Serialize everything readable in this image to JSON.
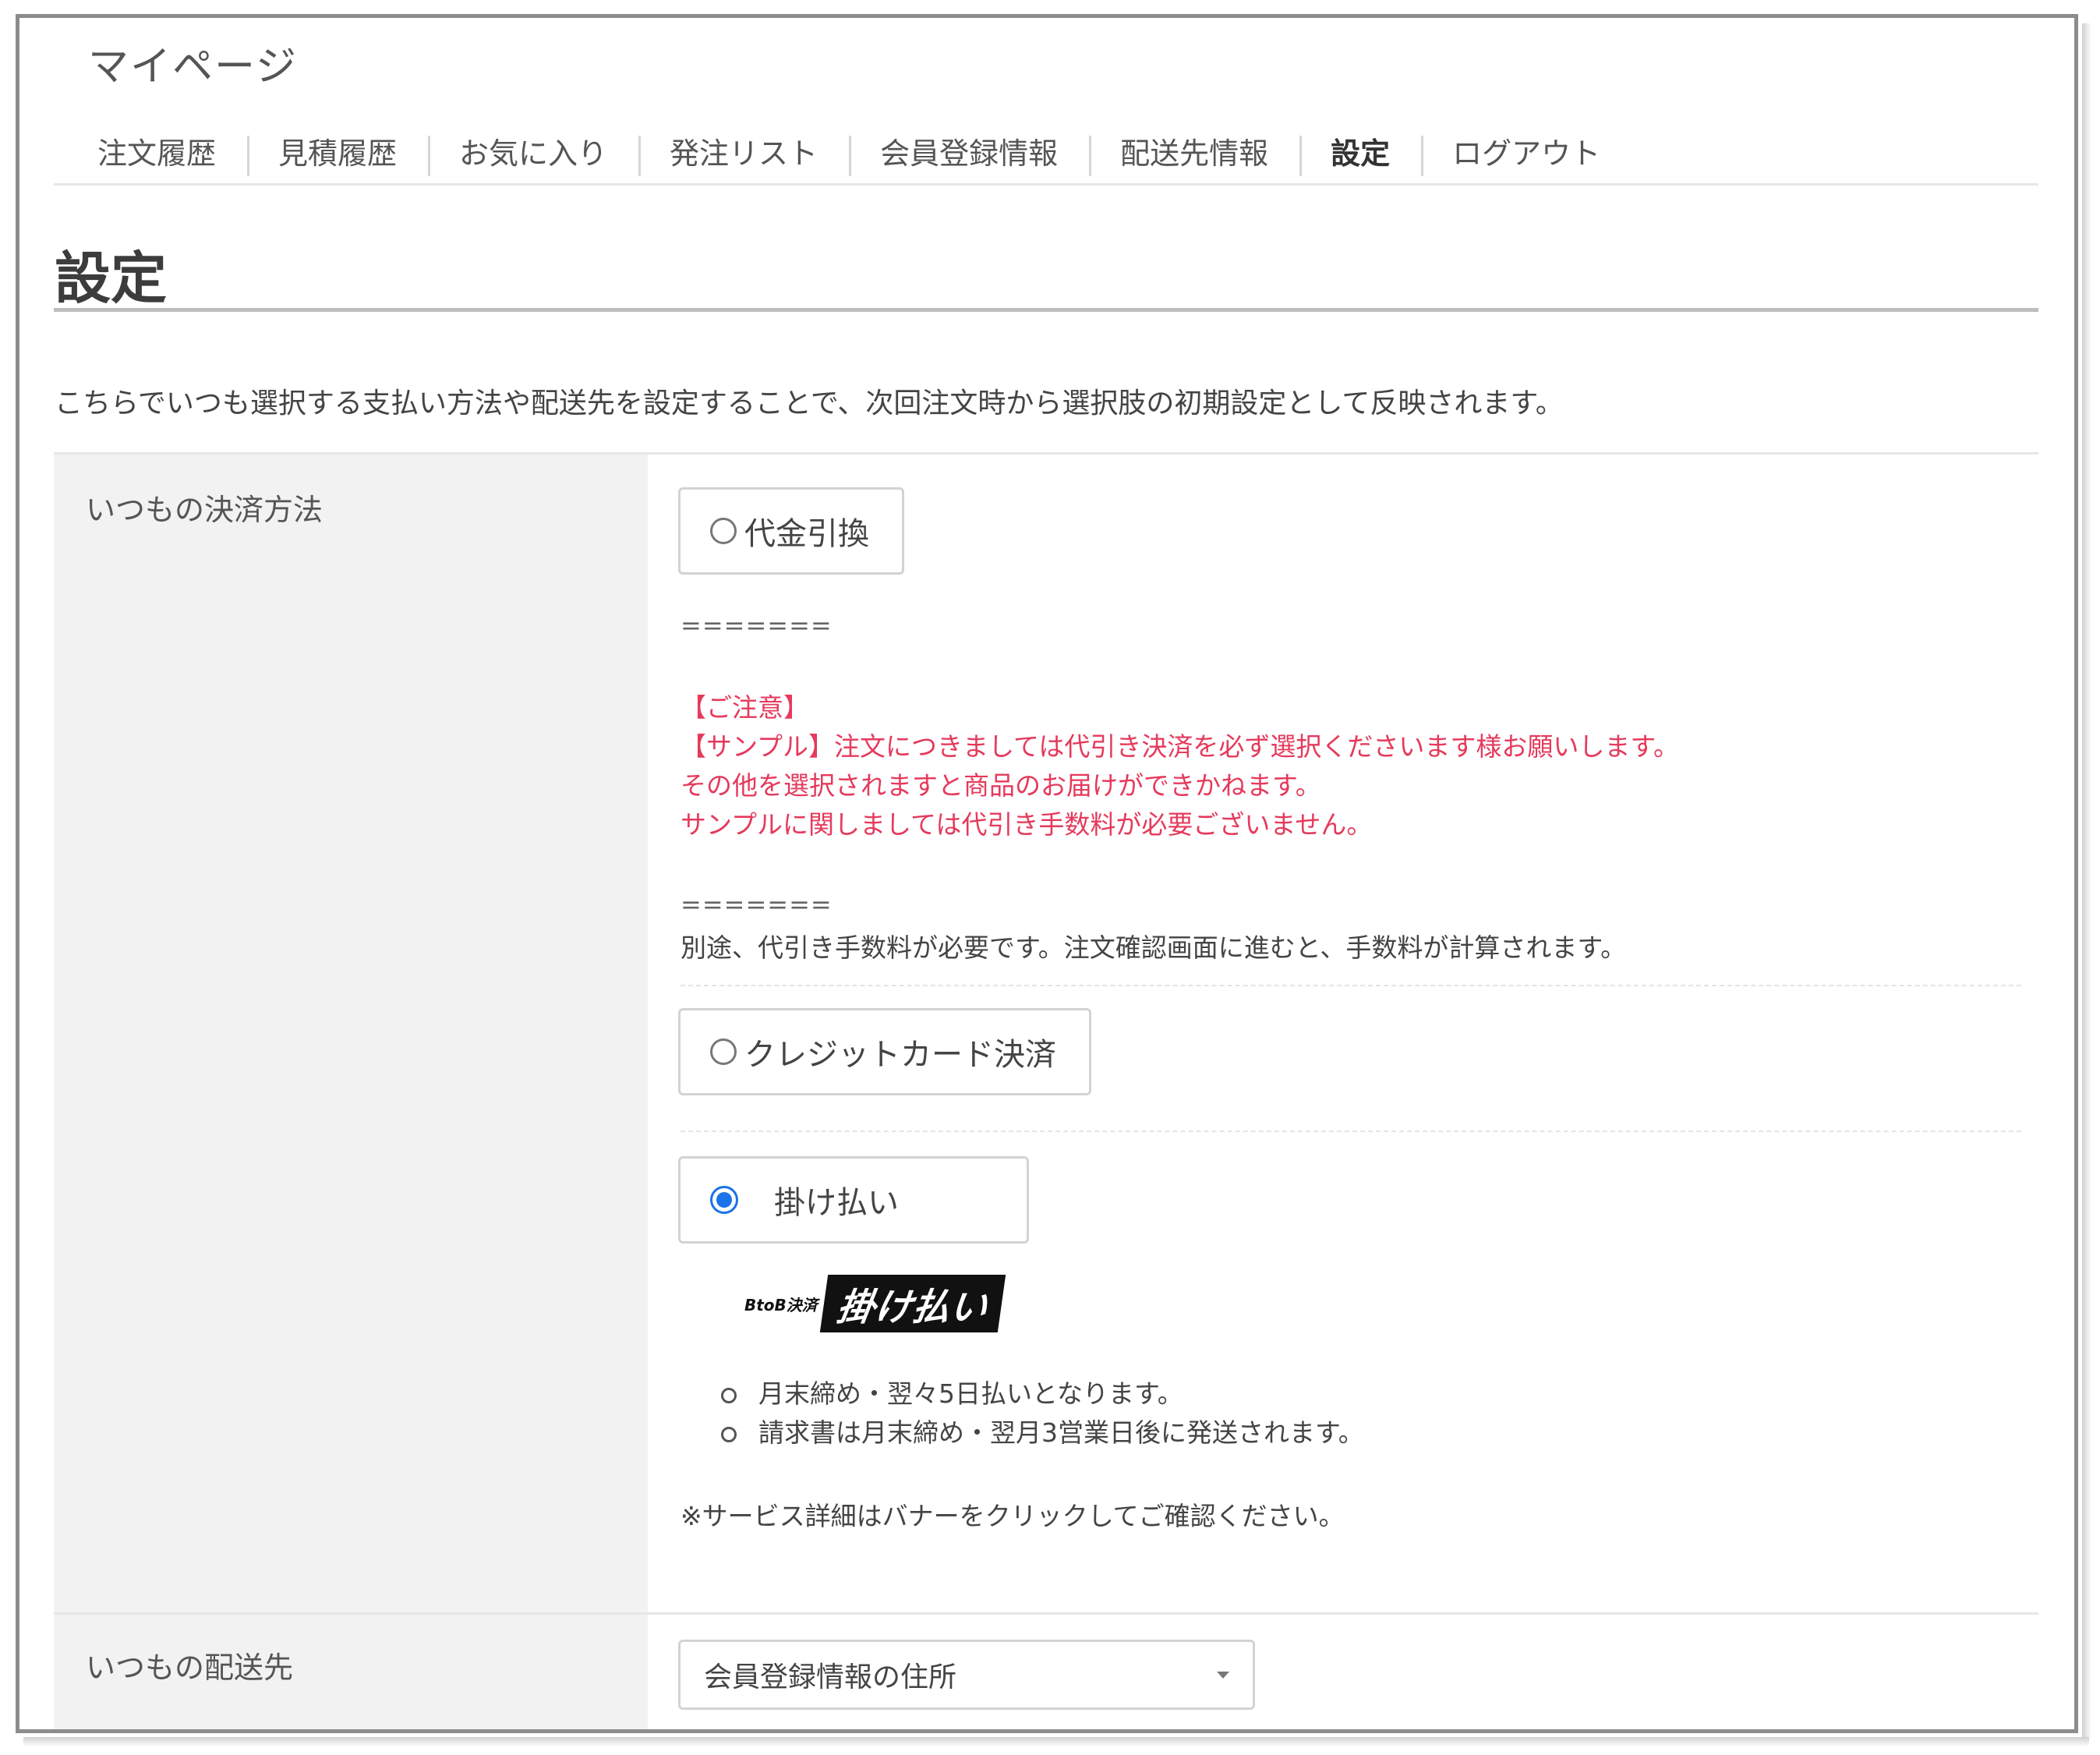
{
  "header": {
    "mypage_title": "マイページ",
    "nav": [
      {
        "label": "注文履歴"
      },
      {
        "label": "見積履歴"
      },
      {
        "label": "お気に入り"
      },
      {
        "label": "発注リスト"
      },
      {
        "label": "会員登録情報"
      },
      {
        "label": "配送先情報"
      },
      {
        "label": "設定"
      },
      {
        "label": "ログアウト"
      }
    ],
    "active_nav": "設定"
  },
  "main": {
    "title": "設定",
    "intro": "こちらでいつも選択する支払い方法や配送先を設定することで、次回注文時から選択肢の初期設定として反映されます。"
  },
  "payment": {
    "label": "いつもの決済方法",
    "option_cod": {
      "label": "代金引換",
      "separator_top": "=======",
      "notice_lines": [
        "【ご注意】",
        "【サンプル】注文につきましては代引き決済を必ず選択くださいます様お願いします。",
        "その他を選択されますと商品のお届けができかねます。",
        "サンプルに関しましては代引き手数料が必要ございません。"
      ],
      "separator_bottom": "=======",
      "fee_note": "別途、代引き手数料が必要です。注文確認画面に進むと、手数料が計算されます。"
    },
    "option_card": {
      "label": "クレジットカード決済"
    },
    "option_invoice": {
      "label": "掛け払い",
      "checked": true,
      "banner_small": "BtoB決済",
      "banner_big": "掛け払い",
      "bullets": [
        "月末締め・翌々5日払いとなります。",
        "請求書は月末締め・翌月3営業日後に発送されます。"
      ],
      "service_note": "※サービス詳細はバナーをクリックしてご確認ください。"
    }
  },
  "shipping": {
    "label": "いつもの配送先",
    "selected": "会員登録情報の住所"
  },
  "colors": {
    "notice_red": "#e53a5c",
    "radio_blue": "#1a73e8",
    "label_bg": "#f2f2f2"
  }
}
